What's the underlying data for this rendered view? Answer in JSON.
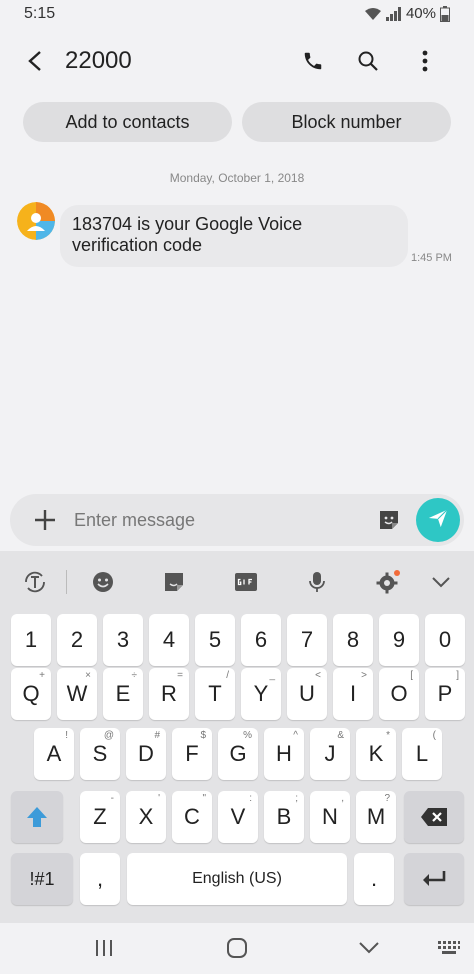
{
  "status": {
    "time": "5:15",
    "battery": "40%"
  },
  "header": {
    "title": "22000",
    "icons": [
      "back-icon",
      "phone-icon",
      "search-icon",
      "more-vert-icon"
    ]
  },
  "actions": {
    "add_contact": "Add to contacts",
    "block": "Block number"
  },
  "conversation": {
    "date": "Monday, October 1, 2018",
    "messages": [
      {
        "line1": "183704 is your Google Voice",
        "line2": "verification code",
        "time": "1:45 PM"
      }
    ]
  },
  "composer": {
    "placeholder": "Enter message"
  },
  "keyboard": {
    "numbers": [
      "1",
      "2",
      "3",
      "4",
      "5",
      "6",
      "7",
      "8",
      "9",
      "0"
    ],
    "row1": [
      {
        "k": "Q",
        "s": "+"
      },
      {
        "k": "W",
        "s": "×"
      },
      {
        "k": "E",
        "s": "÷"
      },
      {
        "k": "R",
        "s": "="
      },
      {
        "k": "T",
        "s": "/"
      },
      {
        "k": "Y",
        "s": "_"
      },
      {
        "k": "U",
        "s": "<"
      },
      {
        "k": "I",
        "s": ">"
      },
      {
        "k": "O",
        "s": "["
      },
      {
        "k": "P",
        "s": "]"
      }
    ],
    "row2": [
      {
        "k": "A",
        "s": "!"
      },
      {
        "k": "S",
        "s": "@"
      },
      {
        "k": "D",
        "s": "#"
      },
      {
        "k": "F",
        "s": "$"
      },
      {
        "k": "G",
        "s": "%"
      },
      {
        "k": "H",
        "s": "^"
      },
      {
        "k": "J",
        "s": "&"
      },
      {
        "k": "K",
        "s": "*"
      },
      {
        "k": "L",
        "s": "("
      }
    ],
    "row3": [
      {
        "k": "Z",
        "s": "-"
      },
      {
        "k": "X",
        "s": "'"
      },
      {
        "k": "C",
        "s": "\""
      },
      {
        "k": "V",
        "s": ":"
      },
      {
        "k": "B",
        "s": ";"
      },
      {
        "k": "N",
        "s": ","
      },
      {
        "k": "M",
        "s": "?"
      }
    ],
    "symbols_label": "!#1",
    "comma": ",",
    "space_label": "English (US)",
    "period": "."
  },
  "colors": {
    "send": "#2ec7c5",
    "shift": "#3d9bd9",
    "settings_dot": "#f26b3a"
  }
}
